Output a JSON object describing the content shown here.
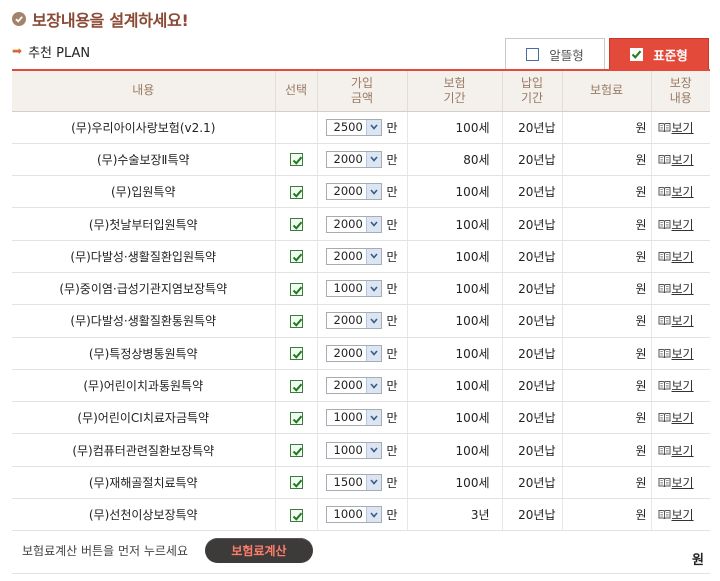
{
  "header": {
    "title": "보장내용을 설계하세요!",
    "subtitle": "추천 PLAN"
  },
  "tabs": [
    {
      "label": "알뜰형",
      "checked": false
    },
    {
      "label": "표준형",
      "checked": true
    }
  ],
  "columns": [
    "내용",
    "선택",
    "가입\n금액",
    "보험\n기간",
    "납입\n기간",
    "보험료",
    "보장\n내용"
  ],
  "rows": [
    {
      "name": "(무)우리아이사랑보험(v2.1)",
      "selected": null,
      "amount": "2500",
      "unit": "만",
      "term": "100세",
      "pay": "20년납",
      "premium": "원",
      "view": "보기"
    },
    {
      "name": "(무)수술보장Ⅱ특약",
      "selected": true,
      "amount": "2000",
      "unit": "만",
      "term": "80세",
      "pay": "20년납",
      "premium": "원",
      "view": "보기"
    },
    {
      "name": "(무)입원특약",
      "selected": true,
      "amount": "2000",
      "unit": "만",
      "term": "100세",
      "pay": "20년납",
      "premium": "원",
      "view": "보기"
    },
    {
      "name": "(무)첫날부터입원특약",
      "selected": true,
      "amount": "2000",
      "unit": "만",
      "term": "100세",
      "pay": "20년납",
      "premium": "원",
      "view": "보기"
    },
    {
      "name": "(무)다발성·생활질환입원특약",
      "selected": true,
      "amount": "2000",
      "unit": "만",
      "term": "100세",
      "pay": "20년납",
      "premium": "원",
      "view": "보기"
    },
    {
      "name": "(무)중이염·급성기관지염보장특약",
      "selected": true,
      "amount": "1000",
      "unit": "만",
      "term": "100세",
      "pay": "20년납",
      "premium": "원",
      "view": "보기"
    },
    {
      "name": "(무)다발성·생활질환통원특약",
      "selected": true,
      "amount": "2000",
      "unit": "만",
      "term": "100세",
      "pay": "20년납",
      "premium": "원",
      "view": "보기"
    },
    {
      "name": "(무)특정상병통원특약",
      "selected": true,
      "amount": "2000",
      "unit": "만",
      "term": "100세",
      "pay": "20년납",
      "premium": "원",
      "view": "보기"
    },
    {
      "name": "(무)어린이치과통원특약",
      "selected": true,
      "amount": "2000",
      "unit": "만",
      "term": "100세",
      "pay": "20년납",
      "premium": "원",
      "view": "보기"
    },
    {
      "name": "(무)어린이CI치료자금특약",
      "selected": true,
      "amount": "1000",
      "unit": "만",
      "term": "100세",
      "pay": "20년납",
      "premium": "원",
      "view": "보기"
    },
    {
      "name": "(무)컴퓨터관련질환보장특약",
      "selected": true,
      "amount": "1000",
      "unit": "만",
      "term": "100세",
      "pay": "20년납",
      "premium": "원",
      "view": "보기"
    },
    {
      "name": "(무)재해골절치료특약",
      "selected": true,
      "amount": "1500",
      "unit": "만",
      "term": "100세",
      "pay": "20년납",
      "premium": "원",
      "view": "보기"
    },
    {
      "name": "(무)선천이상보장특약",
      "selected": true,
      "amount": "1000",
      "unit": "만",
      "term": "3년",
      "pay": "20년납",
      "premium": "원",
      "view": "보기"
    }
  ],
  "footer": {
    "note": "보험료계산 버튼을 먼저 누르세요",
    "calc_button": "보험료계산",
    "total": "원"
  },
  "colors": {
    "accent_red": "#e34a3a",
    "title_brown": "#8a4a35",
    "header_bg": "#f4f0ec",
    "check_green": "#3c7b3c"
  }
}
